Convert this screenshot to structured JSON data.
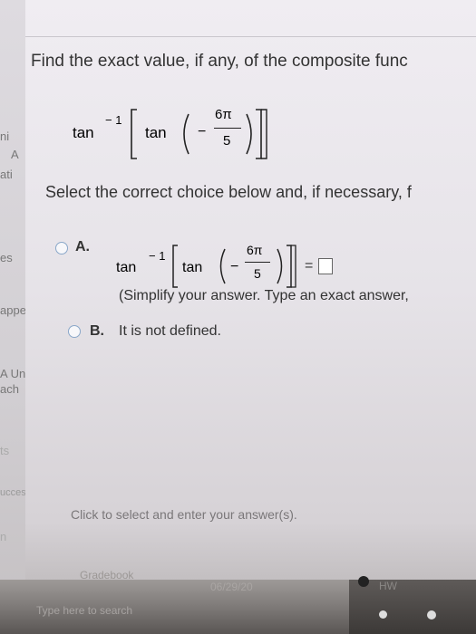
{
  "question": {
    "title": "Find the exact value, if any, of the composite func",
    "expression": {
      "outer_fn": "tan",
      "inverse_exp": "− 1",
      "inner_fn": "tan",
      "minus": "−",
      "numerator": "6π",
      "denominator": "5"
    }
  },
  "instruction": "Select the correct choice below and, if necessary, f",
  "choices": {
    "a": {
      "letter": "A.",
      "outer_fn": "tan",
      "inverse_exp": "− 1",
      "inner_fn": "tan",
      "minus": "−",
      "numerator": "6π",
      "denominator": "5",
      "equals": "=",
      "hint": "(Simplify your answer. Type an exact answer,"
    },
    "b": {
      "letter": "B.",
      "text": "It is not defined."
    }
  },
  "left_strip": {
    "items": [
      "ni",
      "A",
      "ati",
      "es",
      "appe",
      "A Uni",
      "ach",
      "ts",
      "uccess",
      "n"
    ]
  },
  "status_text": "Click to select and enter your answer(s).",
  "taskbar": {
    "gradebook": "Gradebook",
    "date": "06/29/20",
    "search": "Type here to search",
    "hw": "HW"
  }
}
